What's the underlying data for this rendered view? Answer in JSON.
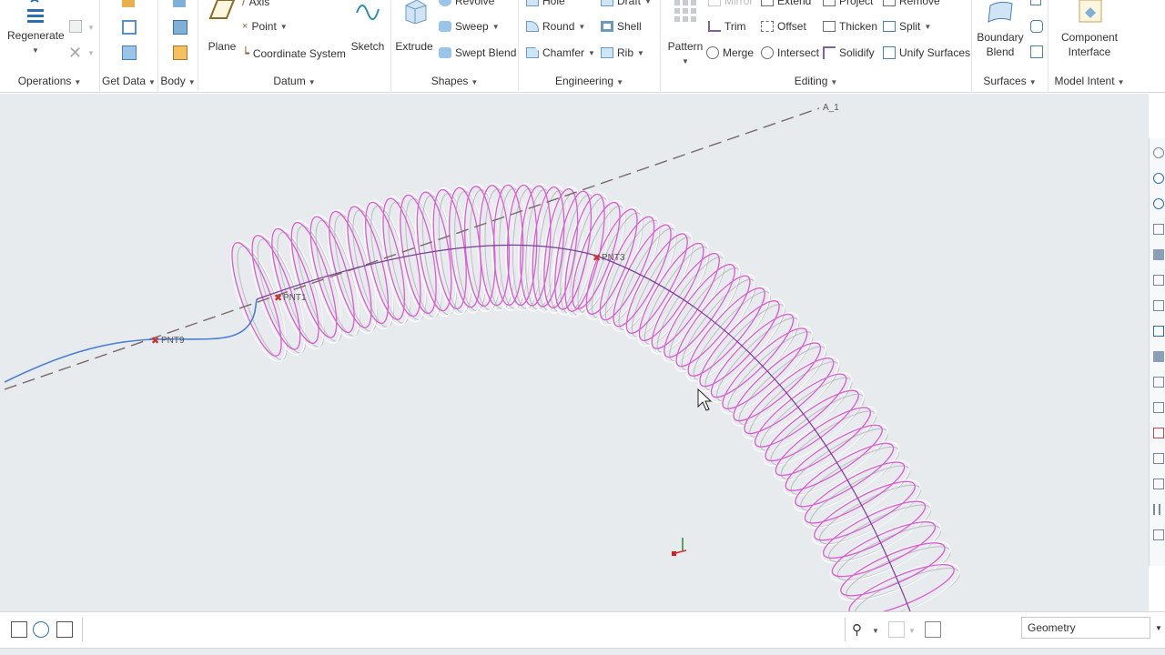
{
  "ribbon": {
    "operations": {
      "regenerate_label": "Regenerate",
      "group_label": "Operations"
    },
    "get_data": {
      "group_label": "Get Data"
    },
    "body": {
      "group_label": "Body"
    },
    "datum": {
      "plane_label": "Plane",
      "axis_label": "Axis",
      "point_label": "Point",
      "coordinate_system_label": "Coordinate System",
      "sketch_label": "Sketch",
      "group_label": "Datum"
    },
    "shapes": {
      "extrude_label": "Extrude",
      "revolve_label": "Revolve",
      "sweep_label": "Sweep",
      "swept_blend_label": "Swept Blend",
      "group_label": "Shapes"
    },
    "engineering": {
      "hole_label": "Hole",
      "draft_label": "Draft",
      "round_label": "Round",
      "shell_label": "Shell",
      "chamfer_label": "Chamfer",
      "rib_label": "Rib",
      "group_label": "Engineering"
    },
    "editing": {
      "pattern_label": "Pattern",
      "mirror_label": "Mirror",
      "extend_label": "Extend",
      "project_label": "Project",
      "remove_label": "Remove",
      "trim_label": "Trim",
      "offset_label": "Offset",
      "thicken_label": "Thicken",
      "split_label": "Split",
      "merge_label": "Merge",
      "intersect_label": "Intersect",
      "solidify_label": "Solidify",
      "unify_surfaces_label": "Unify Surfaces",
      "group_label": "Editing"
    },
    "surfaces": {
      "boundary_blend_line1": "Boundary",
      "boundary_blend_line2": "Blend",
      "group_label": "Surfaces"
    },
    "model_intent": {
      "component_interface_line1": "Component",
      "component_interface_line2": "Interface",
      "group_label": "Model Intent"
    }
  },
  "viewport": {
    "axis_label": "A_1",
    "points": [
      "PNT9",
      "PNT1",
      "PNT3"
    ],
    "colors": {
      "background": "#e8ebee",
      "coil": "#d95fd2",
      "coil_hidden": "#a8aaae",
      "curve": "#4a7fd4",
      "axis": "#7a6868",
      "point_marker": "#d03030"
    }
  },
  "statusbar": {
    "filter_value": "Geometry"
  }
}
